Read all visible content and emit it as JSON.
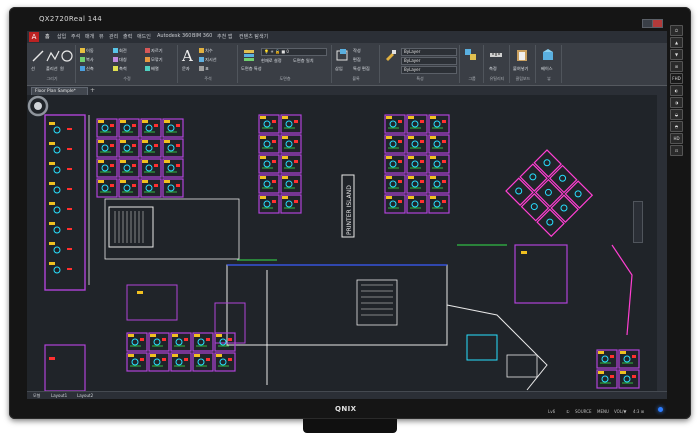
{
  "monitor": {
    "model": "QX2720Real 144",
    "brand": "QNIX",
    "controls": [
      "Lv6",
      "①",
      "SOURCE",
      "MENU",
      "VOL/▼",
      "4:3 ⊞"
    ]
  },
  "app": {
    "button_label": "A",
    "ribbon_tabs": [
      "홈",
      "삽입",
      "주석",
      "매개",
      "뷰",
      "관리",
      "출력",
      "애드인",
      "Autodesk 360",
      "BIM 360",
      "추천 앱",
      "컨텐츠 탐색기"
    ],
    "file_tab": "Floor Plan Sample*",
    "layout_tabs": [
      "모형",
      "Layout1",
      "Layout2"
    ],
    "ribbon": {
      "draw_panel": "그리기",
      "modify_panel": "수정",
      "annotation_panel": "주석",
      "layers_panel": "도면층",
      "block_panel": "블록",
      "properties_panel": "특성",
      "groups_panel": "그룹",
      "utilities_panel": "유틸리티",
      "clipboard_panel": "클립보드",
      "view_panel": "뷰",
      "draw_tools": [
        "선",
        "폴리선",
        "원",
        "호"
      ],
      "modify_tools": [
        "이동",
        "회전",
        "자르기",
        "복사",
        "대칭",
        "모깎기",
        "신축",
        "축척",
        "배열"
      ],
      "annotation_tools": [
        "문자",
        "치수",
        "지시선",
        "표"
      ],
      "layers_tools": [
        "도면층 특성",
        "현재로 설정",
        "도면층 일치"
      ],
      "block_tools": [
        "삽입",
        "작성",
        "편집",
        "특성 편집"
      ],
      "properties_values": [
        "ByLayer",
        "ByLayer",
        "ByLayer"
      ],
      "utilities_tools": [
        "측정"
      ],
      "clipboard_tools": [
        "붙여넣기"
      ],
      "view_tools": [
        "베이스"
      ]
    },
    "plan_label": "PRINTER ISLAND"
  },
  "side_buttons": [
    "⏻",
    "▲",
    "▼",
    "⊞",
    "FHD",
    "◐",
    "◑",
    "◒",
    "◓",
    "HD",
    "⊡"
  ],
  "colors": {
    "wall_purple": "#b043d8",
    "wall_magenta": "#ff3fd2",
    "cyan": "#28e0ff",
    "green": "#35e24a",
    "yellow": "#f0c020",
    "red": "#ff3030",
    "white": "#e8e8e8",
    "blue": "#3a5cff",
    "bg": "#202429"
  }
}
